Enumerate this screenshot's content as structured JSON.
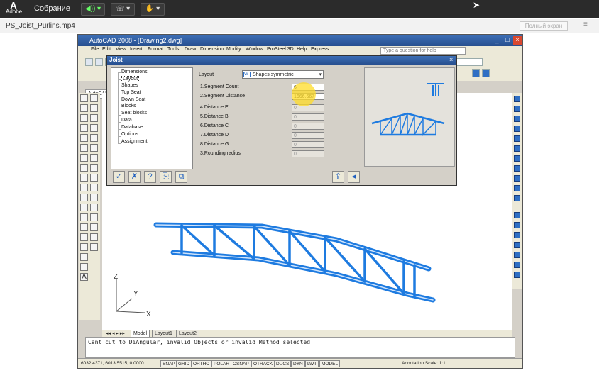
{
  "topbar": {
    "logo_text": "Adobe",
    "meeting_title": "Собрание",
    "audio_icon": "speaker-icon",
    "phone_icon": "phone-icon",
    "hand_icon": "raise-hand-icon",
    "accent": "#2b2b2b"
  },
  "pod": {
    "file_title": "PS_Joist_Purlins.mp4",
    "fullscreen_label": "Полный экран",
    "menu_glyph": "≡"
  },
  "acad": {
    "title": "AutoCAD 2008 - [Drawing2.dwg]",
    "menu": [
      "File",
      "Edit",
      "View",
      "Insert",
      "Format",
      "Tools",
      "Draw",
      "Dimension",
      "Modify",
      "Window",
      "ProSteel 3D",
      "Help",
      "Express"
    ],
    "help_placeholder": "Type a question for help",
    "workspace_tab": "AutoCAD",
    "layout_tabs": [
      "Model",
      "Layout1",
      "Layout2"
    ],
    "command_line": "Cant cut to DiAngular, invalid Objects or invalid Method selected",
    "coords": "6032.4371, 6013.5515, 0.0000",
    "status_buttons": [
      "SNAP",
      "GRID",
      "ORTHO",
      "POLAR",
      "OSNAP",
      "OTRACK",
      "DUCS",
      "DYN",
      "LWT",
      "MODEL"
    ],
    "annotation_scale": "Annotation Scale: 1:1",
    "axis_labels": [
      "Z",
      "Y",
      "X"
    ]
  },
  "joist": {
    "title": "Joist",
    "close_glyph": "×",
    "tree": [
      "Dimensions",
      "Layout",
      "Shapes",
      "Top Seat",
      "Down Seat",
      "Blocks",
      "Seat blocks",
      "Data",
      "Database",
      "Options",
      "Assignment"
    ],
    "selected_tree_item": "Layout",
    "layout_label": "Layout",
    "layout_value": "Shapes symmetric",
    "fields": [
      {
        "label": "1.Segment Count",
        "value": "6",
        "enabled": true
      },
      {
        "label": "2.Segment Distance",
        "value": "1666.667",
        "enabled": true
      },
      {
        "label": "4.Distance E",
        "value": "0",
        "enabled": false
      },
      {
        "label": "5.Distance B",
        "value": "0",
        "enabled": false
      },
      {
        "label": "6.Distance C",
        "value": "0",
        "enabled": false
      },
      {
        "label": "7.Distance D",
        "value": "0",
        "enabled": false
      },
      {
        "label": "8.Distance G",
        "value": "0",
        "enabled": false
      },
      {
        "label": "3.Rounding radius",
        "value": "0",
        "enabled": false
      }
    ],
    "buttons": [
      {
        "name": "ok-icon",
        "glyph": "✓"
      },
      {
        "name": "cancel-icon",
        "glyph": "✗"
      },
      {
        "name": "help-icon",
        "glyph": "?"
      },
      {
        "name": "copy-icon",
        "glyph": "⎘"
      },
      {
        "name": "paste-icon",
        "glyph": "⧉"
      },
      {
        "name": "export-icon",
        "glyph": "⇪"
      },
      {
        "name": "back-icon",
        "glyph": "◂"
      }
    ]
  },
  "colors": {
    "truss_blue": "#1e7be0",
    "title_blue": "#2f5fa8",
    "dialog_gray": "#d4d0c8"
  }
}
